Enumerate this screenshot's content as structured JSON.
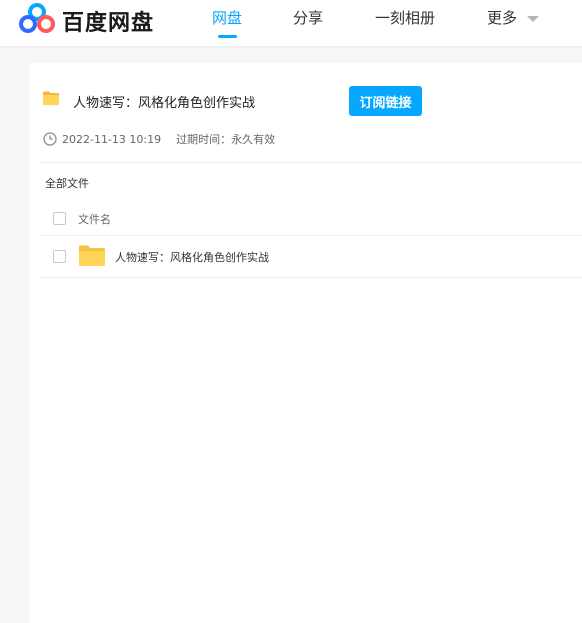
{
  "header": {
    "logo_text": "百度网盘",
    "nav": [
      {
        "label": "网盘",
        "active": true
      },
      {
        "label": "分享",
        "active": false
      },
      {
        "label": "一刻相册",
        "active": false
      },
      {
        "label": "更多",
        "active": false
      }
    ]
  },
  "share": {
    "title": "人物速写：风格化角色创作实战",
    "subscribe_label": "订阅链接",
    "date": "2022-11-13 10:19",
    "expiry": "过期时间：永久有效"
  },
  "file_list": {
    "breadcrumb": "全部文件",
    "column_header": "文件名",
    "rows": [
      {
        "name": "人物速写：风格化角色创作实战",
        "icon": "folder-icon"
      }
    ]
  },
  "colors": {
    "accent": "#06a7ff",
    "folder": "#ffd558"
  },
  "icons": {
    "logo": "baidu-netdisk-logo",
    "clock": "clock-icon",
    "caret": "chevron-down-icon"
  }
}
